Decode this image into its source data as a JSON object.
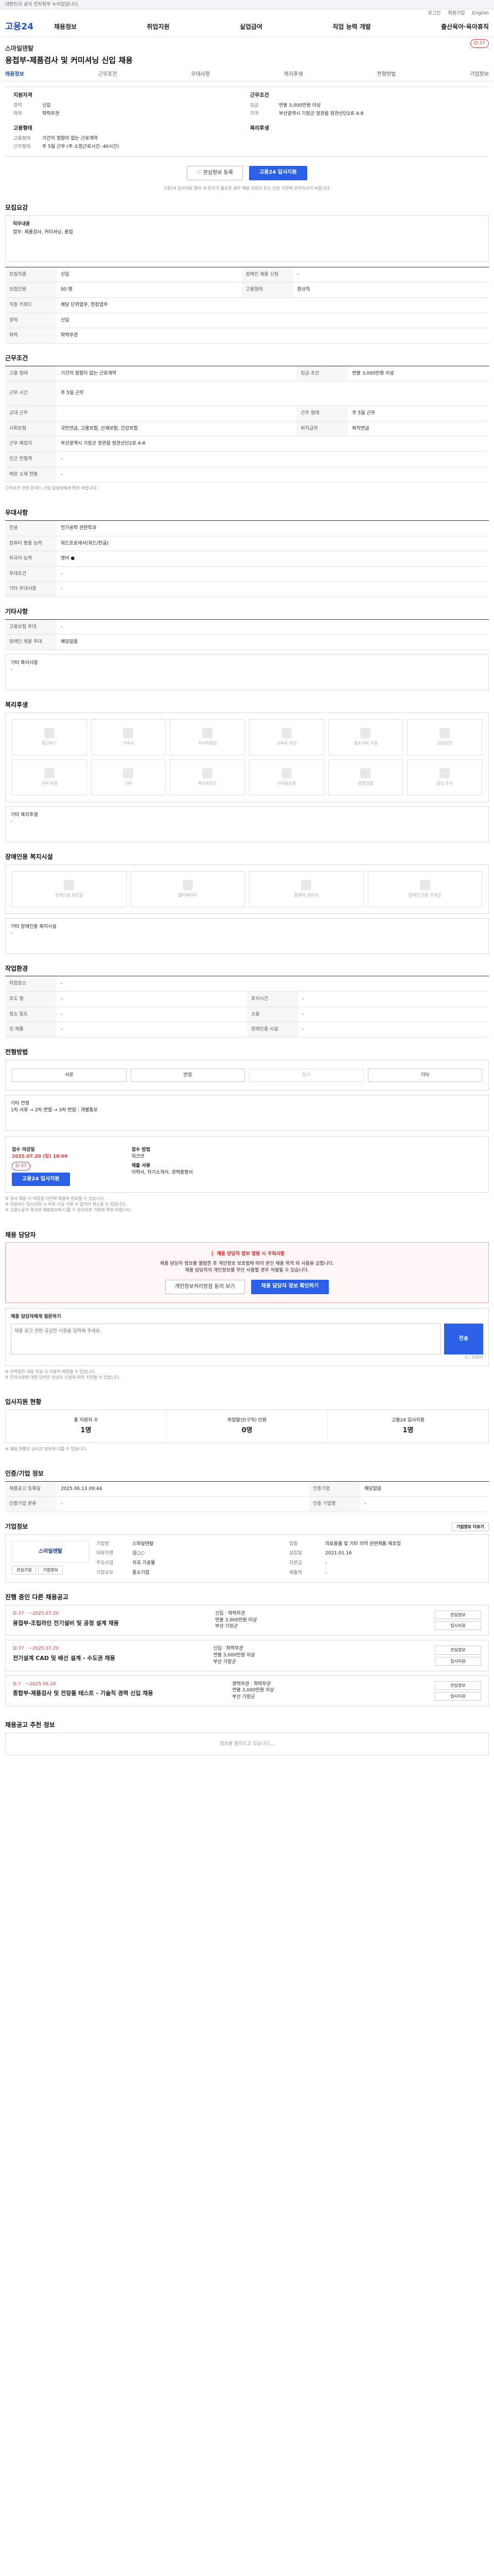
{
  "topbar": {
    "notice": "대한민국 공식 전자정부 누리집입니다."
  },
  "util": {
    "login": "로그인",
    "join": "회원가입",
    "lang": "English"
  },
  "gnb": {
    "logo": "고용24",
    "items": [
      "채용정보",
      "취업지원",
      "실업급여",
      "직업 능력 개발",
      "출산육아·육아휴직"
    ]
  },
  "job": {
    "company": "스마일덴탈",
    "title": "용접부-제품검사 및 커미셔닝 신입 채용",
    "dday": "D-37"
  },
  "tabs": [
    "채용정보",
    "근무조건",
    "우대사항",
    "복리후생",
    "전형방법",
    "기업정보"
  ],
  "summary": {
    "left_title": "지원자격",
    "left_rows": [
      [
        "경력",
        "신입"
      ],
      [
        "학력",
        "학력무관"
      ]
    ],
    "left_title2": "고용형태",
    "left_rows2": [
      [
        "고용형태",
        "기간의 정함이 없는 근로계약"
      ],
      [
        "근무형태",
        "주 5일 근무 (주 소정근로시간: 40시간)"
      ]
    ],
    "right_title": "근무조건",
    "right_rows": [
      [
        "임금",
        "연봉 3,000만원 이상"
      ],
      [
        "지역",
        "부산광역시 기장군 정관읍 정관산단2로 4-8"
      ]
    ],
    "right_title2": "복리후생",
    "right_rows2": []
  },
  "actions": {
    "fav": "관심정보 등록",
    "apply": "고용24 입사지원"
  },
  "summary_note": "고용24 입사지원 절차 내 문의가 필요한 경우 채용 담당자 또는 담당 기관에 문의하시기 바랍니다.",
  "s_recruit": {
    "title": "모집요강",
    "content_label": "직무내용",
    "content": "업무: 제품검사, 커미셔닝, 용접",
    "table": [
      [
        "모집직종",
        "신입",
        "장애인 채용 신청",
        "-"
      ],
      [
        "모집인원",
        "00 명",
        "고용형태",
        "정규직"
      ],
      [
        "직종 키워드",
        "해당 단위업무, 현장업무",
        "",
        ""
      ],
      [
        "경력",
        "신입",
        "",
        ""
      ],
      [
        "학력",
        "학력무관",
        "",
        ""
      ]
    ]
  },
  "s_work": {
    "title": "근무조건",
    "rows": [
      [
        "고용 형태",
        "기간의 정함이 없는 근로계약",
        "임금 조건",
        "연봉 3,000만원 이상"
      ],
      [
        "근무 시간",
        "주 5일 근무",
        "",
        ""
      ],
      [
        "교대 근무",
        "",
        "근무 형태",
        "주 5일 근무"
      ],
      [
        "사회보험",
        "국민연금, 고용보험, 산재보험, 건강보험",
        "퇴직급여",
        "퇴직연금"
      ],
      [
        "근무 예정지",
        "부산광역시 기장군 정관읍 정관산단2로 4-8",
        "",
        ""
      ],
      [
        "인근 전철역",
        "-",
        "",
        ""
      ],
      [
        "매장 소재 현황",
        "-",
        "",
        ""
      ]
    ],
    "note": "근무조건 관련 문의는 기업 담당자에게 확인 바랍니다."
  },
  "s_pref": {
    "title": "우대사항",
    "rows": [
      [
        "전공",
        "전기공학 관련학과"
      ],
      [
        "컴퓨터 활용 능력",
        "워드프로세서(워드/한글)"
      ],
      [
        "외국어 능력",
        "영어 ●"
      ],
      [
        "우대조건",
        "-"
      ],
      [
        "기타 우대사항",
        "-"
      ]
    ]
  },
  "s_etc": {
    "title": "기타사항",
    "rows": [
      [
        "고용보험 우대",
        "-"
      ],
      [
        "장애인 채용 우대",
        "해당없음"
      ]
    ],
    "sub": "기타 특이사항",
    "sub_val": "-"
  },
  "s_welfare": {
    "title": "복리후생",
    "items": [
      "통근버스",
      "기숙사",
      "자녀학자금",
      "교육비 지원",
      "경조사비 지원",
      "건강검진",
      "식비 지원",
      "기타",
      "복지포인트",
      "사내동호회",
      "명절선물",
      "설날·추석"
    ],
    "other_label": "기타 복리후생",
    "other_val": "-"
  },
  "s_disab": {
    "title": "장애인용 복지시설",
    "items": [
      "장애인용 화장실",
      "엘리베이터",
      "휠체어 경사로",
      "장애인 전용 주차장"
    ],
    "other_label": "기타 장애인용 복지시설",
    "other_val": "-"
  },
  "s_env": {
    "title": "작업환경",
    "rows": [
      [
        "작업장소",
        "-",
        "",
        ""
      ],
      [
        "조도 형",
        "-",
        "휴식시간",
        "-"
      ],
      [
        "청소 밀도",
        "-",
        "소음",
        "-"
      ],
      [
        "진 제품",
        "-",
        "장애인용 시설",
        "-"
      ]
    ]
  },
  "s_method": {
    "title": "전형방법",
    "buttons": [
      "서류",
      "면접",
      "필기",
      "기타"
    ],
    "sub_title": "기타 전형",
    "sub_val": "1차 서류 → 2차 면접 → 3차 면접 : 개별통보"
  },
  "s_period": {
    "period_label": "접수 마감일",
    "period_val": "2025.07.20 (일) 18:00",
    "dday": "D-37",
    "apply": "고용24 입사지원",
    "method_label": "접수 방법",
    "method_val": "워크넷",
    "doc_label": "제출 서류",
    "doc_val": "이력서, 자기소개서, 경력증명서",
    "notes": [
      "※ 상시 채용 시 마감일 이전에 채용이 완료될 수 있습니다.",
      "※ 지원자는 입사지원 시 허위 사실 기재 시 합격이 취소될 수 있습니다.",
      "※ 고용노동부 워크넷 채용정보와 다를 수 있으므로 기업에 확인 바랍니다."
    ]
  },
  "s_contact": {
    "title": "채용 담당자",
    "pink_title": "채용 담당자 정보 열람 시 주의사항",
    "pink_text": "채용 담당자 정보를 열람한 후 개인정보 보호법에 따라 본인 채용 목적 외 사용을 금합니다.",
    "pink_text2": "채용 담당자의 개인정보를 무단 사용할 경우 처벌될 수 있습니다.",
    "btn1": "개인정보처리방침 동의 보기",
    "btn2": "채용 담당자 정보 확인하기",
    "q_title": "채용 담당자에게 질문하기",
    "q_placeholder": "채용 공고 관련 궁금한 사항을 입력해 주세요.",
    "q_count": "0 / 500자",
    "q_send": "전송",
    "q_notes": [
      "※ 부적절한 내용 작성 시 이용이 제한될 수 있습니다.",
      "※ 문의사항에 대한 답변은 담당자 사정에 따라 지연될 수 있습니다."
    ]
  },
  "s_stats": {
    "title": "입사지원 현황",
    "updated": "기준일자",
    "items": [
      [
        "총 지원자 수",
        "1명"
      ],
      [
        "취업알선(구직) 인원",
        "0명"
      ],
      [
        "고용24 입사지원",
        "1명"
      ]
    ],
    "note": "※ 채용 현황은 실시간 정보와 다를 수 있습니다."
  },
  "s_info": {
    "title": "인증/기업 정보",
    "rows": [
      [
        "채용공고 등록일",
        "2025.06.13 09:44",
        "인증기업",
        "해당없음"
      ],
      [
        "인증기업 분류",
        "-",
        "인증 기업명",
        "-"
      ]
    ]
  },
  "s_company": {
    "title": "기업정보",
    "more": "기업정보 더보기",
    "logo": "스마일덴탈",
    "rows": [
      [
        "기업명",
        "스마일덴탈",
        "업종",
        "의료용품 및 기타 의약 관련제품 제조업"
      ],
      [
        "대표자명",
        "김○○",
        "설립일",
        "2021.01.16"
      ],
      [
        "주요사업",
        "치과 기공물",
        "자본금",
        "-"
      ],
      [
        "기업규모",
        "중소기업",
        "매출액",
        "-"
      ]
    ],
    "btns": [
      "관심기업",
      "기업정보"
    ]
  },
  "s_other": {
    "title": "진행 중인 다른 채용공고",
    "items": [
      {
        "dday": "D-37 · ~2025.07.20",
        "title": "용접부-조립라인 전기설비 및 공정 설계 채용",
        "a": "신입",
        "b": "학력무관",
        "c": "연봉 3,000만원 이상",
        "d": "부산 기장군"
      },
      {
        "dday": "D-37 · ~2025.07.20",
        "title": "전기설계 CAD 및 배선 설계 - 수도권 채용",
        "a": "신입",
        "b": "학력무관",
        "c": "연봉 3,000만원 이상",
        "d": "부산 기장군"
      },
      {
        "dday": "D-7 · ~2025.06.20",
        "title": "종합부-제품검사 및 전장품 테스트 - 기술직 경력 신입 채용",
        "a": "경력무관",
        "b": "학력무관",
        "c": "연봉 3,000만원 이상",
        "d": "부산 기장군"
      }
    ],
    "side": [
      "관심정보",
      "입사지원"
    ]
  },
  "s_recommend": {
    "title": "채용공고 추천 정보",
    "loading": "정보를 불러오고 있습니다..."
  }
}
